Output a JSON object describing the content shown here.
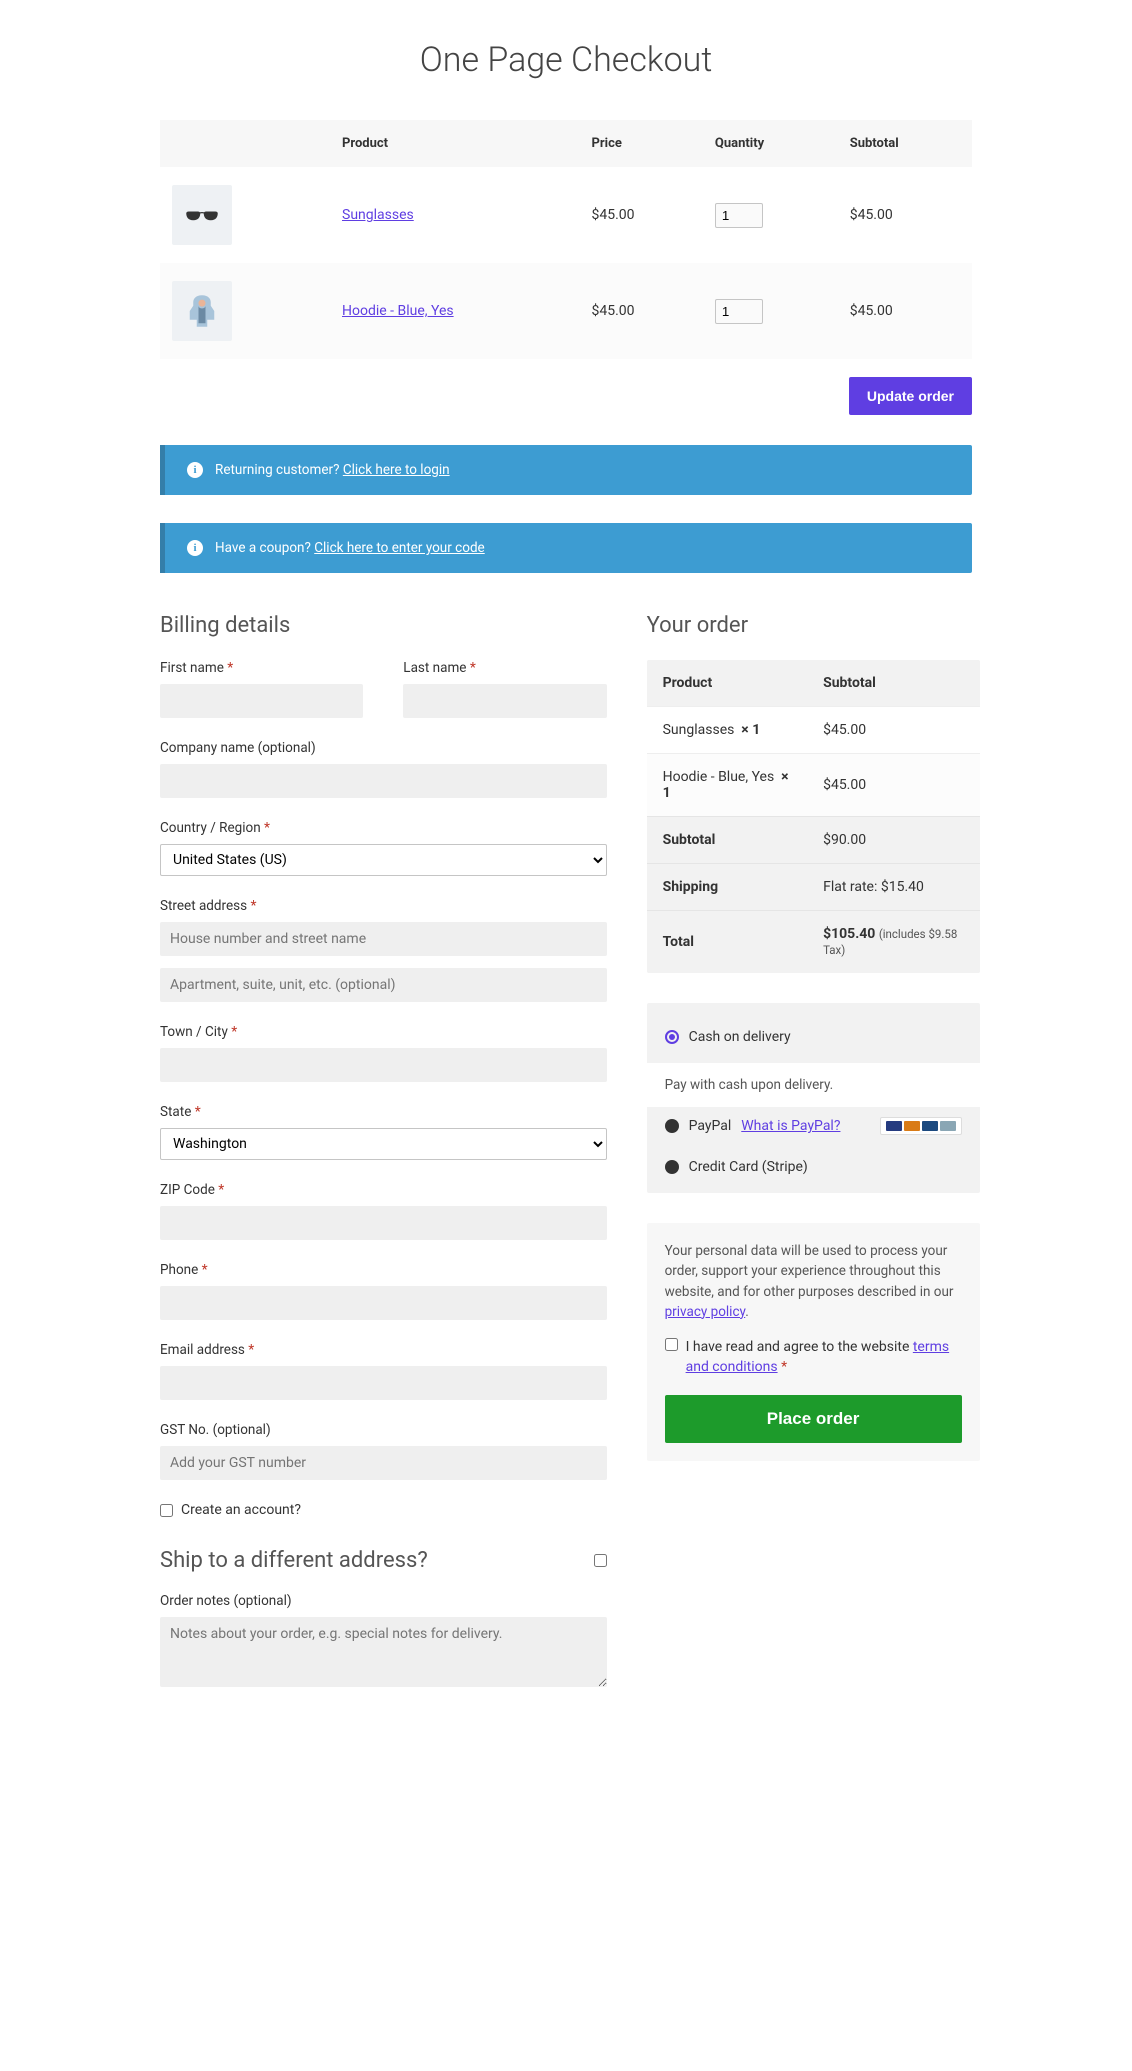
{
  "page_title": "One Page Checkout",
  "cart": {
    "headers": {
      "product": "Product",
      "price": "Price",
      "qty": "Quantity",
      "subtotal": "Subtotal"
    },
    "items": [
      {
        "name": "Sunglasses",
        "price": "$45.00",
        "qty": "1",
        "subtotal": "$45.00"
      },
      {
        "name": "Hoodie - Blue, Yes",
        "price": "$45.00",
        "qty": "1",
        "subtotal": "$45.00"
      }
    ],
    "update_btn": "Update order"
  },
  "banners": {
    "returning": {
      "text": "Returning customer?",
      "link": "Click here to login"
    },
    "coupon": {
      "text": "Have a coupon?",
      "link": "Click here to enter your code"
    }
  },
  "billing": {
    "heading": "Billing details",
    "labels": {
      "first_name": "First name",
      "last_name": "Last name",
      "company": "Company name (optional)",
      "country": "Country / Region",
      "street": "Street address",
      "city": "Town / City",
      "state": "State",
      "zip": "ZIP Code",
      "phone": "Phone",
      "email": "Email address",
      "gst": "GST No. (optional)",
      "create_account": "Create an account?"
    },
    "country_value": "United States (US)",
    "state_value": "Washington",
    "street_placeholder": "House number and street name",
    "street2_placeholder": "Apartment, suite, unit, etc. (optional)",
    "gst_placeholder": "Add your GST number"
  },
  "shipping": {
    "heading": "Ship to a different address?",
    "notes_label": "Order notes (optional)",
    "notes_placeholder": "Notes about your order, e.g. special notes for delivery."
  },
  "order": {
    "heading": "Your order",
    "headers": {
      "product": "Product",
      "subtotal": "Subtotal"
    },
    "lines": [
      {
        "name": "Sunglasses",
        "qty": "× 1",
        "subtotal": "$45.00"
      },
      {
        "name": "Hoodie - Blue, Yes",
        "qty": "× 1",
        "subtotal": "$45.00"
      }
    ],
    "subtotal_label": "Subtotal",
    "subtotal_value": "$90.00",
    "shipping_label": "Shipping",
    "shipping_value": "Flat rate: $15.40",
    "total_label": "Total",
    "total_value": "$105.40",
    "tax_note": "(includes $9.58 Tax)"
  },
  "payment": {
    "cod": {
      "label": "Cash on delivery",
      "desc": "Pay with cash upon delivery."
    },
    "paypal": {
      "label": "PayPal",
      "what": "What is PayPal?"
    },
    "stripe": {
      "label": "Credit Card (Stripe)"
    }
  },
  "place_order": {
    "privacy": "Your personal data will be used to process your order, support your experience throughout this website, and for other purposes described in our ",
    "privacy_link": "privacy policy",
    "terms_pre": "I have read and agree to the website ",
    "terms_link": "terms and conditions",
    "btn": "Place order"
  }
}
